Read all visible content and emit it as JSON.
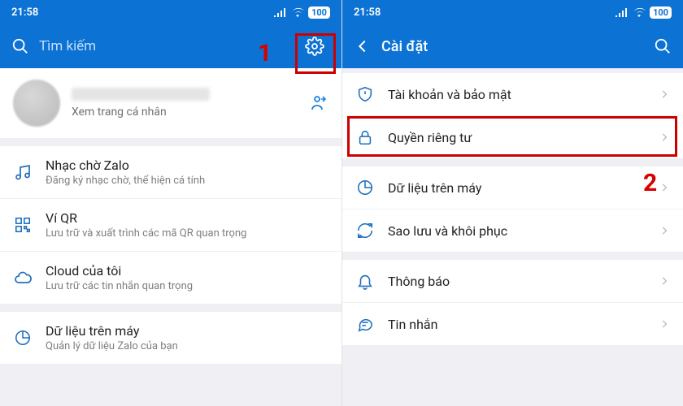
{
  "left": {
    "status": {
      "time": "21:58",
      "battery": "100"
    },
    "header": {
      "search_placeholder": "Tìm kiếm"
    },
    "profile": {
      "subtitle": "Xem trang cá nhân"
    },
    "items": [
      {
        "title": "Nhạc chờ Zalo",
        "sub": "Đăng ký nhạc chờ, thể hiện cá tính"
      },
      {
        "title": "Ví QR",
        "sub": "Lưu trữ và xuất trình các mã QR quan trọng"
      },
      {
        "title": "Cloud của tôi",
        "sub": "Lưu trữ các tin nhắn quan trọng"
      },
      {
        "title": "Dữ liệu trên máy",
        "sub": "Quản lý dữ liệu Zalo của bạn"
      }
    ],
    "annotation": "1"
  },
  "right": {
    "status": {
      "time": "21:58",
      "battery": "100"
    },
    "header": {
      "title": "Cài đặt"
    },
    "items": [
      {
        "title": "Tài khoản và bảo mật"
      },
      {
        "title": "Quyền riêng tư"
      },
      {
        "title": "Dữ liệu trên máy"
      },
      {
        "title": "Sao lưu và khôi phục"
      },
      {
        "title": "Thông báo"
      },
      {
        "title": "Tin nhắn"
      }
    ],
    "annotation": "2"
  }
}
